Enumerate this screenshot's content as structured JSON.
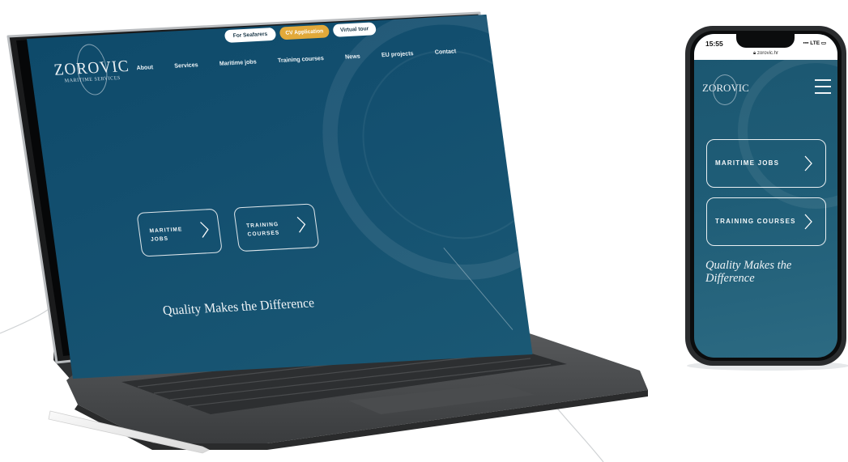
{
  "tablet": {
    "logo_word": "ZOROVIC",
    "logo_sub": "MARITIME SERVICES",
    "top_buttons": [
      "For Seafarers",
      "CV Application",
      "Virtual tour"
    ],
    "nav": [
      "About",
      "Services",
      "Maritime jobs",
      "Training courses",
      "News",
      "EU projects",
      "Contact"
    ],
    "cta": [
      {
        "label_line1": "MARITIME",
        "label_line2": "JOBS"
      },
      {
        "label_line1": "TRAINING",
        "label_line2": "COURSES"
      }
    ],
    "tagline": "Quality Makes the Difference"
  },
  "phone": {
    "time": "15:55",
    "signal": "LTE",
    "url": "zorovic.hr",
    "logo_word": "ZOROVIC",
    "cta": [
      "MARITIME JOBS",
      "TRAINING COURSES"
    ],
    "tagline": "Quality Makes the Difference"
  },
  "colors": {
    "screen_blue": "#134f6f",
    "accent_gold": "#e2a93a",
    "white": "#ffffff"
  },
  "icons": [
    "chevron-right-icon",
    "hamburger-menu-icon",
    "lock-icon"
  ]
}
